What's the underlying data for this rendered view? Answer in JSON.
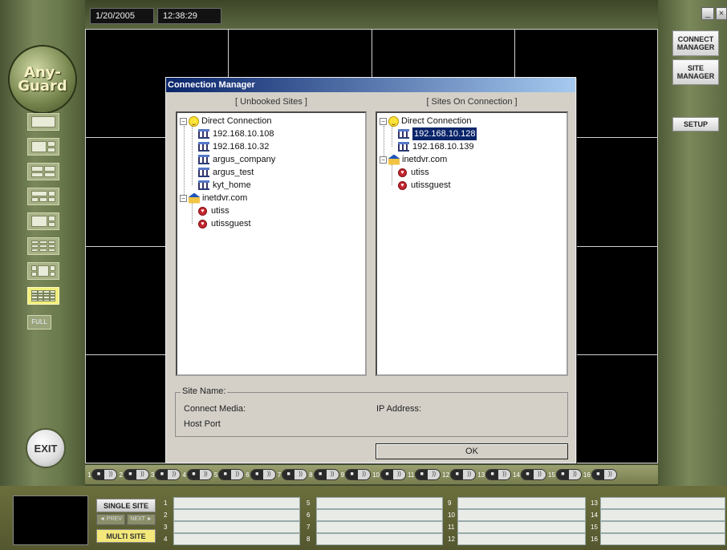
{
  "header": {
    "date": "1/20/2005",
    "time": "12:38:29"
  },
  "logo": {
    "line1": "Any-",
    "line2": "Guard"
  },
  "left_sidebar": {
    "full_label": "FULL",
    "exit_label": "EXIT"
  },
  "right_sidebar": {
    "connect_manager": "CONNECT MANAGER",
    "site_manager": "SITE MANAGER",
    "setup": "SETUP",
    "minimize": "_",
    "close": "×"
  },
  "dialog": {
    "title": "Connection Manager",
    "left_header": "[ Unbooked Sites ]",
    "right_header": "[ Sites On Connection ]",
    "left_tree": {
      "direct": "Direct Connection",
      "direct_children": [
        "192.168.10.108",
        "192.168.10.32",
        "argus_company",
        "argus_test",
        "kyt_home"
      ],
      "inet": "inetdvr.com",
      "inet_children": [
        "utiss",
        "utissguest"
      ]
    },
    "right_tree": {
      "direct": "Direct Connection",
      "direct_children": [
        "192.168.10.128",
        "192.168.10.139"
      ],
      "inet": "inetdvr.com",
      "inet_children": [
        "utiss",
        "utissguest"
      ]
    },
    "site_info": {
      "site_name": "Site Name:",
      "connect_media": "Connect Media:",
      "ip_address": "IP Address:",
      "host_port": "Host Port"
    },
    "ok": "OK"
  },
  "channels": [
    "1",
    "2",
    "3",
    "4",
    "5",
    "6",
    "7",
    "8",
    "9",
    "10",
    "11",
    "12",
    "13",
    "14",
    "15",
    "16"
  ],
  "bottom": {
    "single_site": "SINGLE SITE",
    "prev": "◄ PREV",
    "next": "NEXT ►",
    "multi_site": "MULTI SITE",
    "slot_numbers": [
      "1",
      "2",
      "3",
      "4",
      "5",
      "6",
      "7",
      "8",
      "9",
      "10",
      "11",
      "12",
      "13",
      "14",
      "15",
      "16"
    ]
  }
}
